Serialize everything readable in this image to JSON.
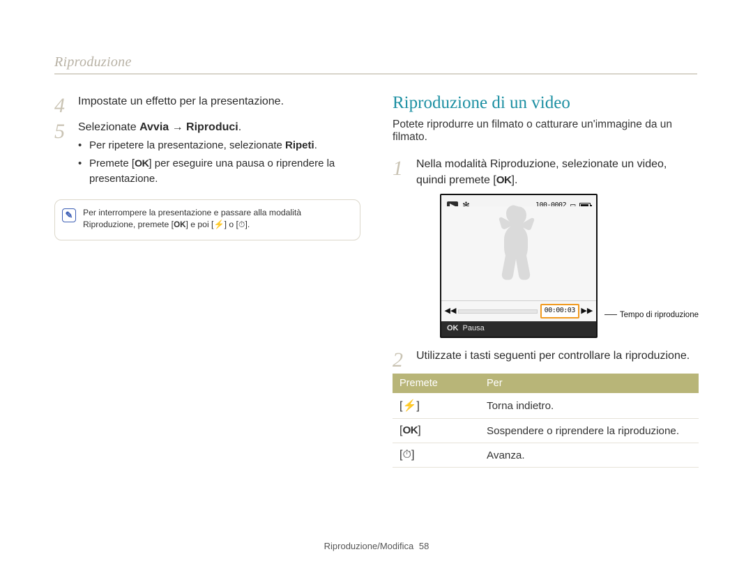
{
  "running_head": "Riproduzione",
  "left": {
    "step4": "Impostate un effetto per la presentazione.",
    "step5_pre": "Selezionate ",
    "step5_bold": "Avvia → Riproduci",
    "step5_post": ".",
    "bullet1_pre": "Per ripetere la presentazione, selezionate ",
    "bullet1_bold": "Ripeti",
    "bullet1_post": ".",
    "bullet2_pre": "Premete [",
    "bullet2_ok": "OK",
    "bullet2_post": "] per eseguire una pausa o riprendere la presentazione.",
    "note_line1_a": "Per interrompere la presentazione e passare alla modalità Riproduzione, premete [",
    "note_ok": "OK",
    "note_line1_b": "] e poi [",
    "note_flash": "⚡",
    "note_line1_c": "] o [",
    "note_timer": "⏱",
    "note_line1_d": "]."
  },
  "right": {
    "heading": "Riproduzione di un video",
    "intro": "Potete riprodurre un filmato o catturare un'immagine da un filmato.",
    "step1_a": "Nella modalità Riproduzione, selezionate un video, quindi premete [",
    "step1_ok": "OK",
    "step1_b": "].",
    "shot": {
      "counter": "100-0002",
      "timecode": "00:00:03",
      "pause_ok": "OK",
      "pause_label": "Pausa"
    },
    "playback_time_label": "Tempo di riproduzione",
    "step2": "Utilizzate i tasti seguenti per controllare la riproduzione.",
    "table": {
      "head_press": "Premete",
      "head_to": "Per",
      "rows": [
        {
          "key_left": "[",
          "key_glyph": "⚡",
          "key_right": "]",
          "desc": "Torna indietro."
        },
        {
          "key_left": "[",
          "key_glyph": "OK",
          "key_right": "]",
          "desc": "Sospendere o riprendere la riproduzione."
        },
        {
          "key_left": "[",
          "key_glyph": "⏱",
          "key_right": "]",
          "desc": "Avanza."
        }
      ]
    }
  },
  "footer": {
    "section": "Riproduzione/Modifica",
    "page": "58"
  }
}
